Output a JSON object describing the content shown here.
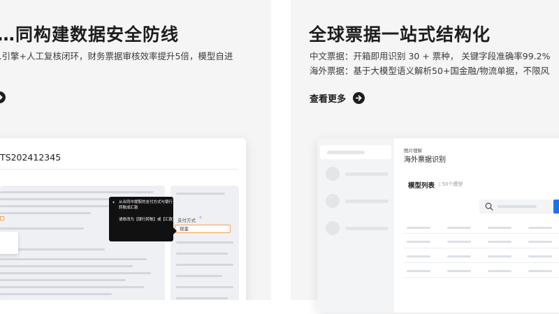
{
  "left_card": {
    "title": "…同构建数据安全防线",
    "desc_line1": "…引擎+人工复核闭环，财务票据审核效率提升5倍，模型自进",
    "mockup": {
      "doc_id": "TS202412345",
      "tooltip": {
        "line1": "从合同中提取的支付方式与银行",
        "line2": "转账成汇款",
        "line3": "请修改为【银行转账】或【汇款】"
      },
      "pay_label": "支付方式",
      "pay_value": "现金"
    }
  },
  "right_card": {
    "title": "全球票据一站式结构化",
    "desc_line1": "中文票据：开箱即用识别 30 + 票种， 关键字段准确率99.2%",
    "desc_line2": "海外票据：基于大模型语义解析50+国金融/物流单据，不限风",
    "more_label": "查看更多",
    "mockup": {
      "breadcrumb": "图片理解",
      "page_title": "海外票据识别",
      "section_title": "模型列表",
      "section_count": "| 50个模型"
    }
  },
  "icons": {
    "arrow": "arrow-right-circle-icon",
    "search": "search-icon",
    "sparkle": "sparkle-icon"
  },
  "colors": {
    "card_bg": "#f5f5f5",
    "accent_blue": "#1a73e8",
    "highlight_orange": "#f0a050",
    "tooltip_bg": "#111111"
  }
}
